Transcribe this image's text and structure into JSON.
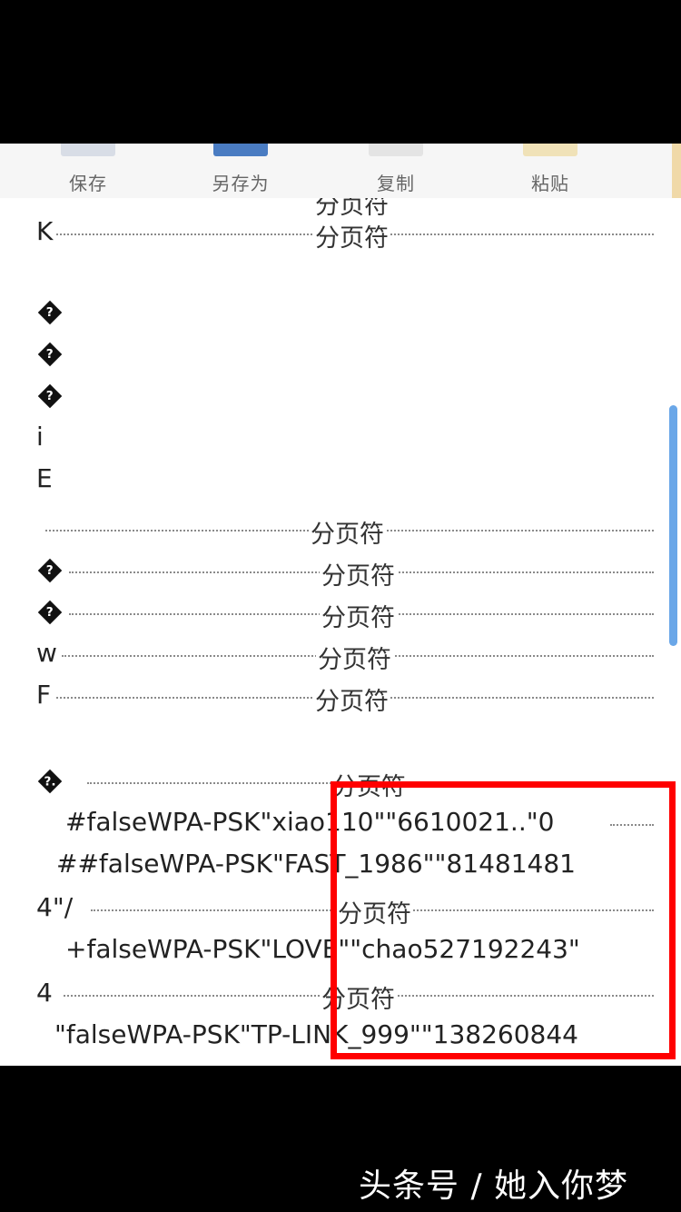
{
  "toolbar": {
    "items": [
      {
        "label": "保存",
        "icon": "save-icon"
      },
      {
        "label": "另存为",
        "icon": "save-as-icon"
      },
      {
        "label": "复制",
        "icon": "copy-icon"
      },
      {
        "label": "粘贴",
        "icon": "paste-icon"
      }
    ],
    "accent": "#4a7cc2"
  },
  "document": {
    "page_break_label": "分页符",
    "lines": {
      "l0": "K",
      "l1": "?",
      "l2": "?",
      "l3": "?",
      "l4": "i",
      "l5": "E",
      "l7": "?",
      "l8": "?",
      "l9": "w",
      "l10": "F",
      "l11": "?.",
      "l12": "#falseWPA-PSK\"xiao110\"\"6610021..\"0",
      "l13": "##falseWPA-PSK\"FAST_1986\"\"81481481",
      "l14": "4\"/",
      "l15": "+falseWPA-PSK\"LOVE\"\"chao527192243\"",
      "l16": "4",
      "l17": "\"falseWPA-PSK\"TP-LINK_999\"\"138260844"
    }
  },
  "annotation": {
    "color": "#ff0000"
  },
  "watermark": "头条号 / 她入你梦"
}
